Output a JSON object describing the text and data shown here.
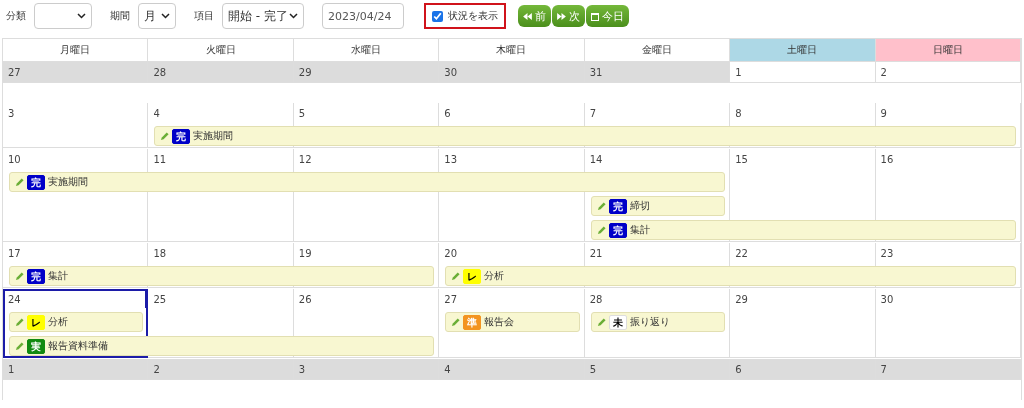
{
  "toolbar": {
    "category": {
      "label": "分類"
    },
    "period": {
      "label": "期間",
      "value": "月"
    },
    "item": {
      "label": "項目",
      "value": "開始 - 完了"
    },
    "date": {
      "value": "2023/04/24"
    },
    "show_status": {
      "label": "状況を表示",
      "checked": true,
      "highlighted": true
    },
    "nav_buttons": [
      {
        "kind": "prev",
        "label": "前"
      },
      {
        "kind": "next",
        "label": "次"
      },
      {
        "kind": "today",
        "label": "今日"
      }
    ]
  },
  "calendar": {
    "weekdays": [
      {
        "label": "月曜日",
        "kind": "weekday"
      },
      {
        "label": "火曜日",
        "kind": "weekday"
      },
      {
        "label": "水曜日",
        "kind": "weekday"
      },
      {
        "label": "木曜日",
        "kind": "weekday"
      },
      {
        "label": "金曜日",
        "kind": "weekday"
      },
      {
        "label": "土曜日",
        "kind": "saturday"
      },
      {
        "label": "日曜日",
        "kind": "sunday"
      }
    ],
    "weeks": [
      {
        "days": [
          {
            "date": "27",
            "other_month": true,
            "today": false
          },
          {
            "date": "28",
            "other_month": true,
            "today": false
          },
          {
            "date": "29",
            "other_month": true,
            "today": false
          },
          {
            "date": "30",
            "other_month": true,
            "today": false
          },
          {
            "date": "31",
            "other_month": true,
            "today": false
          },
          {
            "date": "1",
            "other_month": false,
            "today": false
          },
          {
            "date": "2",
            "other_month": false,
            "today": false
          }
        ]
      },
      {
        "days": [
          {
            "date": "3",
            "other_month": false,
            "today": false
          },
          {
            "date": "4",
            "other_month": false,
            "today": false
          },
          {
            "date": "5",
            "other_month": false,
            "today": false
          },
          {
            "date": "6",
            "other_month": false,
            "today": false
          },
          {
            "date": "7",
            "other_month": false,
            "today": false
          },
          {
            "date": "8",
            "other_month": false,
            "today": false
          },
          {
            "date": "9",
            "other_month": false,
            "today": false
          }
        ],
        "lanes": [
          [
            {
              "kind": "empty"
            },
            {
              "kind": "start",
              "status": {
                "kind": "done",
                "label": "完"
              },
              "title": "実施期間"
            },
            {
              "kind": "continued"
            },
            {
              "kind": "continued"
            },
            {
              "kind": "continued"
            },
            {
              "kind": "continued"
            },
            {
              "kind": "continued"
            }
          ]
        ]
      },
      {
        "days": [
          {
            "date": "10",
            "other_month": false,
            "today": false
          },
          {
            "date": "11",
            "other_month": false,
            "today": false
          },
          {
            "date": "12",
            "other_month": false,
            "today": false
          },
          {
            "date": "13",
            "other_month": false,
            "today": false
          },
          {
            "date": "14",
            "other_month": false,
            "today": false
          },
          {
            "date": "15",
            "other_month": false,
            "today": false
          },
          {
            "date": "16",
            "other_month": false,
            "today": false
          }
        ],
        "lanes": [
          [
            {
              "kind": "start",
              "status": {
                "kind": "done",
                "label": "完"
              },
              "title": "実施期間"
            },
            {
              "kind": "continued"
            },
            {
              "kind": "continued"
            },
            {
              "kind": "continued"
            },
            {
              "kind": "continued"
            },
            {
              "kind": "empty"
            },
            {
              "kind": "empty"
            }
          ],
          [
            {
              "kind": "empty"
            },
            {
              "kind": "empty"
            },
            {
              "kind": "empty"
            },
            {
              "kind": "empty"
            },
            {
              "kind": "start",
              "status": {
                "kind": "done",
                "label": "完"
              },
              "title": "締切"
            },
            {
              "kind": "empty"
            },
            {
              "kind": "empty"
            }
          ],
          [
            {
              "kind": "empty"
            },
            {
              "kind": "empty"
            },
            {
              "kind": "empty"
            },
            {
              "kind": "empty"
            },
            {
              "kind": "start",
              "status": {
                "kind": "done",
                "label": "完"
              },
              "title": "集計"
            },
            {
              "kind": "continued"
            },
            {
              "kind": "continued"
            }
          ]
        ]
      },
      {
        "days": [
          {
            "date": "17",
            "other_month": false,
            "today": false
          },
          {
            "date": "18",
            "other_month": false,
            "today": false
          },
          {
            "date": "19",
            "other_month": false,
            "today": false
          },
          {
            "date": "20",
            "other_month": false,
            "today": false
          },
          {
            "date": "21",
            "other_month": false,
            "today": false
          },
          {
            "date": "22",
            "other_month": false,
            "today": false
          },
          {
            "date": "23",
            "other_month": false,
            "today": false
          }
        ],
        "lanes": [
          [
            {
              "kind": "start",
              "status": {
                "kind": "done",
                "label": "完"
              },
              "title": "集計"
            },
            {
              "kind": "continued"
            },
            {
              "kind": "continued"
            },
            {
              "kind": "start",
              "status": {
                "kind": "review",
                "label": "レ"
              },
              "title": "分析"
            },
            {
              "kind": "continued"
            },
            {
              "kind": "continued"
            },
            {
              "kind": "continued"
            }
          ]
        ]
      },
      {
        "days": [
          {
            "date": "24",
            "other_month": false,
            "today": true
          },
          {
            "date": "25",
            "other_month": false,
            "today": false
          },
          {
            "date": "26",
            "other_month": false,
            "today": false
          },
          {
            "date": "27",
            "other_month": false,
            "today": false
          },
          {
            "date": "28",
            "other_month": false,
            "today": false
          },
          {
            "date": "29",
            "other_month": false,
            "today": false
          },
          {
            "date": "30",
            "other_month": false,
            "today": false
          }
        ],
        "lanes": [
          [
            {
              "kind": "start",
              "status": {
                "kind": "review",
                "label": "レ"
              },
              "title": "分析"
            },
            {
              "kind": "empty"
            },
            {
              "kind": "empty"
            },
            {
              "kind": "start",
              "status": {
                "kind": "prep",
                "label": "準"
              },
              "title": "報告会"
            },
            {
              "kind": "start",
              "status": {
                "kind": "todo",
                "label": "未"
              },
              "title": "振り返り"
            },
            {
              "kind": "empty"
            },
            {
              "kind": "empty"
            }
          ],
          [
            {
              "kind": "start",
              "status": {
                "kind": "doing",
                "label": "実"
              },
              "title": "報告資料準備"
            },
            {
              "kind": "continued"
            },
            {
              "kind": "continued"
            },
            {
              "kind": "empty"
            },
            {
              "kind": "empty"
            },
            {
              "kind": "empty"
            },
            {
              "kind": "empty"
            }
          ]
        ]
      },
      {
        "days": [
          {
            "date": "1",
            "other_month": true,
            "today": false
          },
          {
            "date": "2",
            "other_month": true,
            "today": false
          },
          {
            "date": "3",
            "other_month": true,
            "today": false
          },
          {
            "date": "4",
            "other_month": true,
            "today": false
          },
          {
            "date": "5",
            "other_month": true,
            "today": false
          },
          {
            "date": "6",
            "other_month": true,
            "today": false
          },
          {
            "date": "7",
            "other_month": true,
            "today": false
          }
        ]
      }
    ]
  }
}
